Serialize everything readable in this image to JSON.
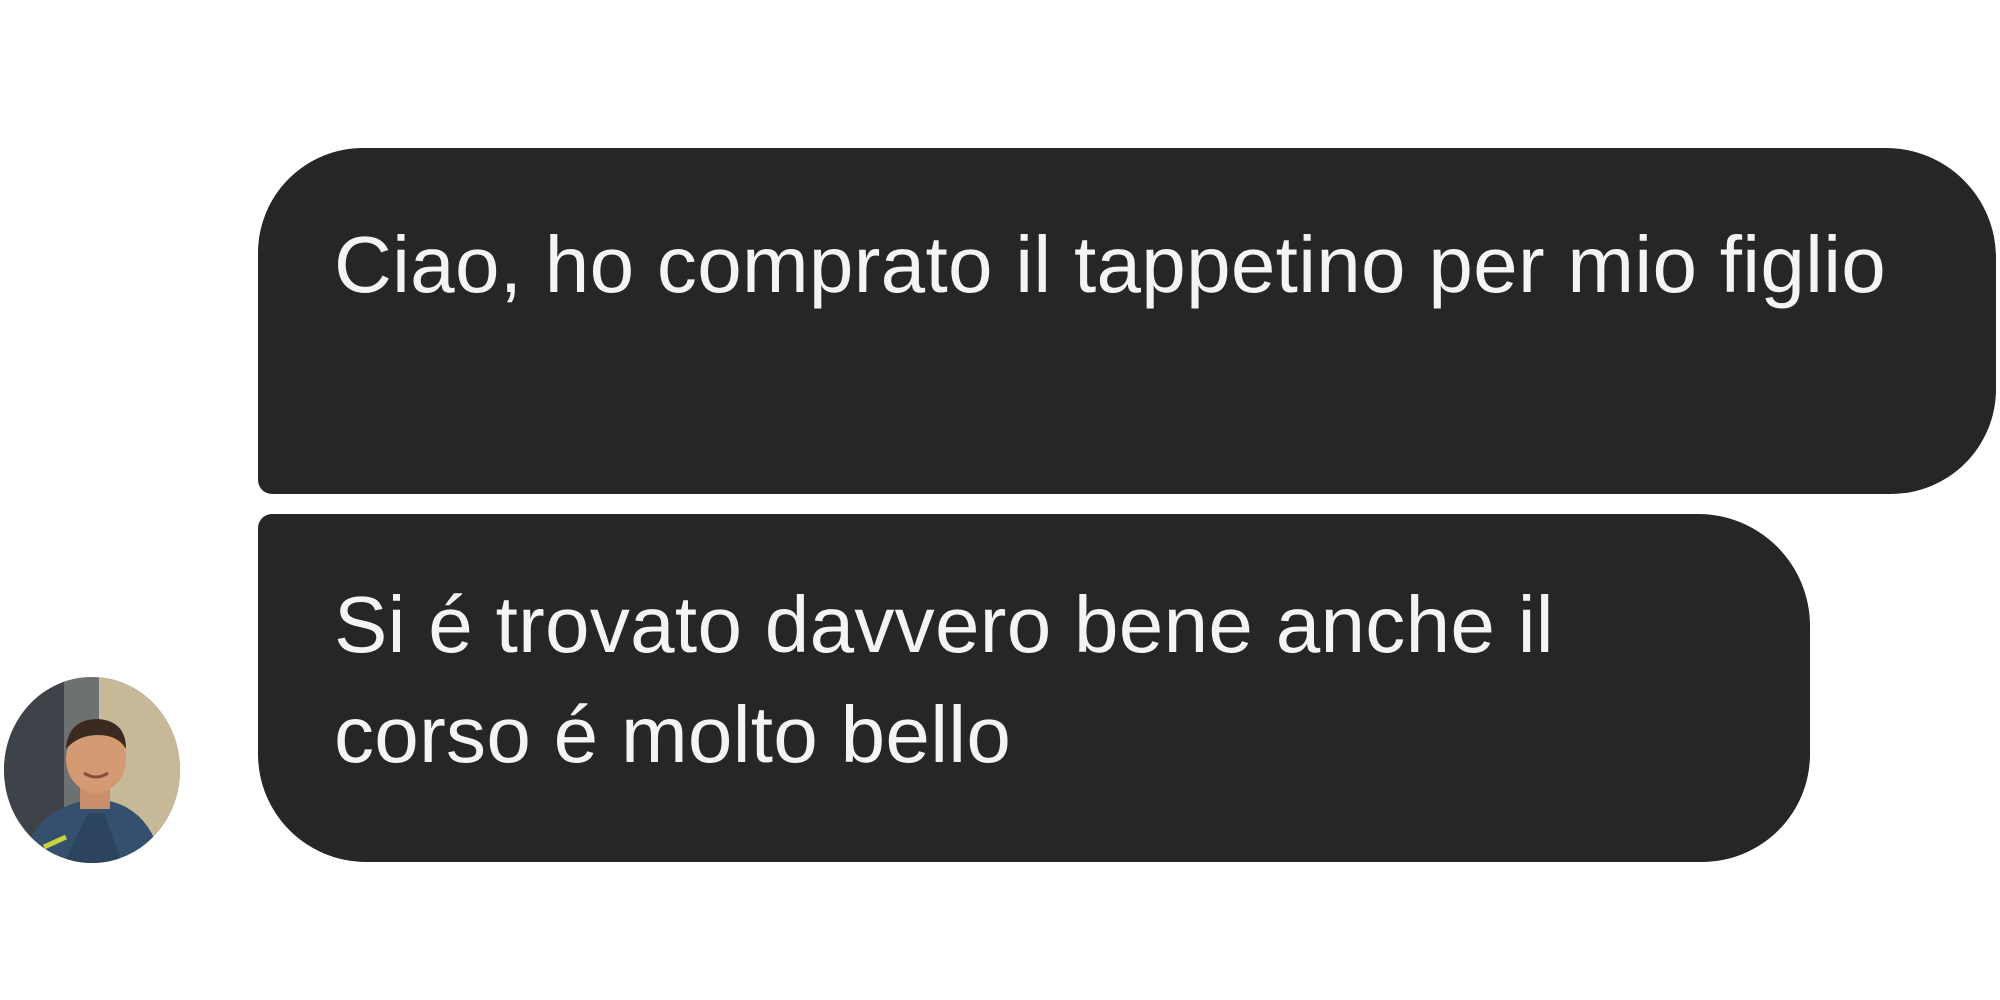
{
  "messages": [
    {
      "text": "Ciao, ho comprato il tappetino per mio figlio"
    },
    {
      "text": "Si é trovato davvero bene anche il corso é molto bello"
    }
  ],
  "sender": {
    "avatar_icon": "user-photo-avatar"
  },
  "colors": {
    "bubble": "#262626",
    "text": "#f4f4f4",
    "background": "#ffffff"
  }
}
